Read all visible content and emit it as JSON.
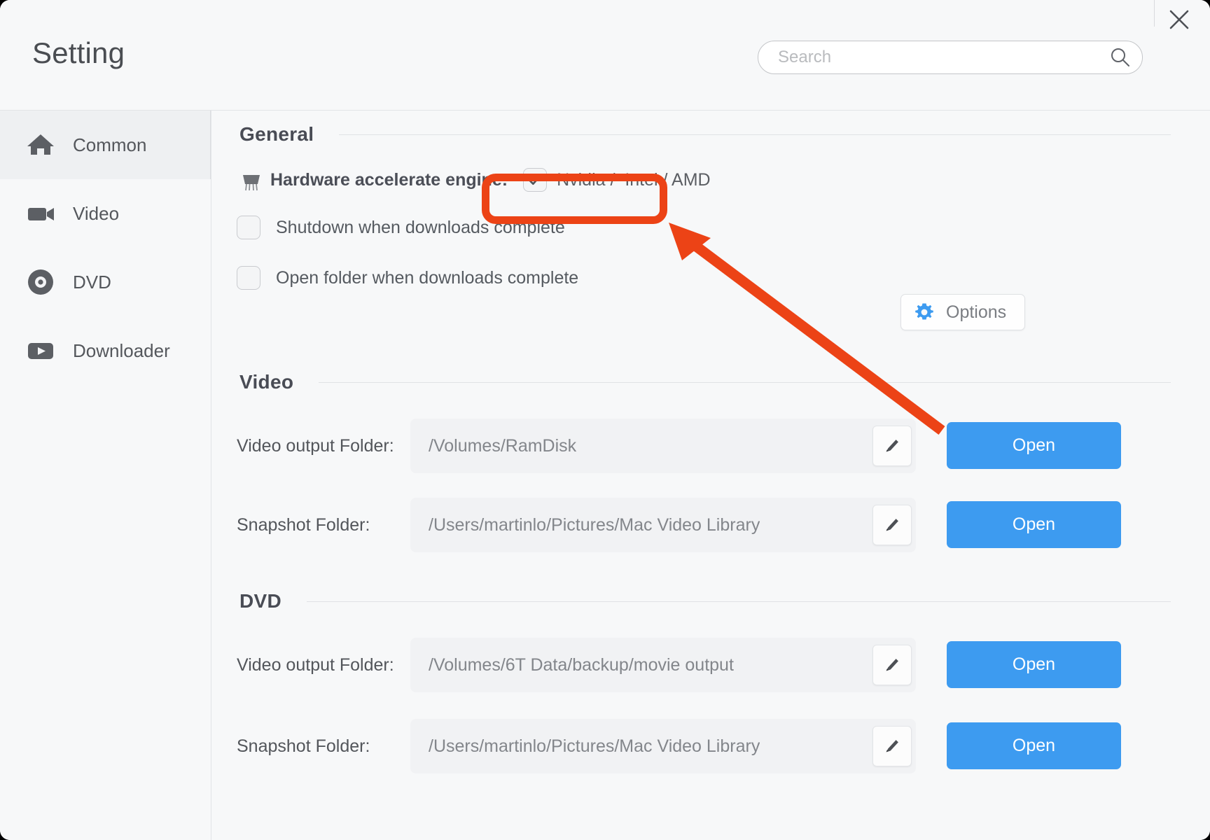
{
  "window": {
    "title": "Setting",
    "close_icon": "close-icon"
  },
  "search": {
    "placeholder": "Search",
    "value": "",
    "icon": "search-icon"
  },
  "sidebar": {
    "items": [
      {
        "label": "Common",
        "icon": "home-icon",
        "selected": true
      },
      {
        "label": "Video",
        "icon": "video-camera-icon",
        "selected": false
      },
      {
        "label": "DVD",
        "icon": "disc-icon",
        "selected": false
      },
      {
        "label": "Downloader",
        "icon": "play-box-icon",
        "selected": false
      }
    ]
  },
  "general": {
    "section_title": "General",
    "hardware": {
      "icon": "cpu-chip-icon",
      "label": "Hardware accelerate engine:",
      "checkbox_label": "Nvidia /  Intel / AMD",
      "checked": true,
      "options_button": {
        "label": "Options",
        "icon": "gear-icon"
      }
    },
    "options": [
      {
        "label": "Shutdown when downloads complete",
        "checked": false
      },
      {
        "label": "Open folder when downloads complete",
        "checked": false
      }
    ]
  },
  "video": {
    "section_title": "Video",
    "rows": [
      {
        "label": "Video output Folder:",
        "path": "/Volumes/RamDisk",
        "edit_icon": "pencil-icon",
        "open_label": "Open"
      },
      {
        "label": "Snapshot Folder:",
        "path": "/Users/martinlo/Pictures/Mac Video Library",
        "edit_icon": "pencil-icon",
        "open_label": "Open"
      }
    ]
  },
  "dvd": {
    "section_title": "DVD",
    "rows": [
      {
        "label": "Video output Folder:",
        "path": "/Volumes/6T Data/backup/movie output",
        "edit_icon": "pencil-icon",
        "open_label": "Open"
      },
      {
        "label": "Snapshot Folder:",
        "path": "/Users/martinlo/Pictures/Mac Video Library",
        "edit_icon": "pencil-icon",
        "open_label": "Open"
      }
    ]
  },
  "annotation": {
    "highlight_color": "#ec4316",
    "arrow_color": "#ec4316",
    "target": "Nvidia /  Intel / AMD"
  },
  "colors": {
    "accent_blue": "#3d9bf0",
    "annotation_orange": "#ec4316",
    "background": "#f7f8f9",
    "field_background": "#f1f2f4"
  }
}
